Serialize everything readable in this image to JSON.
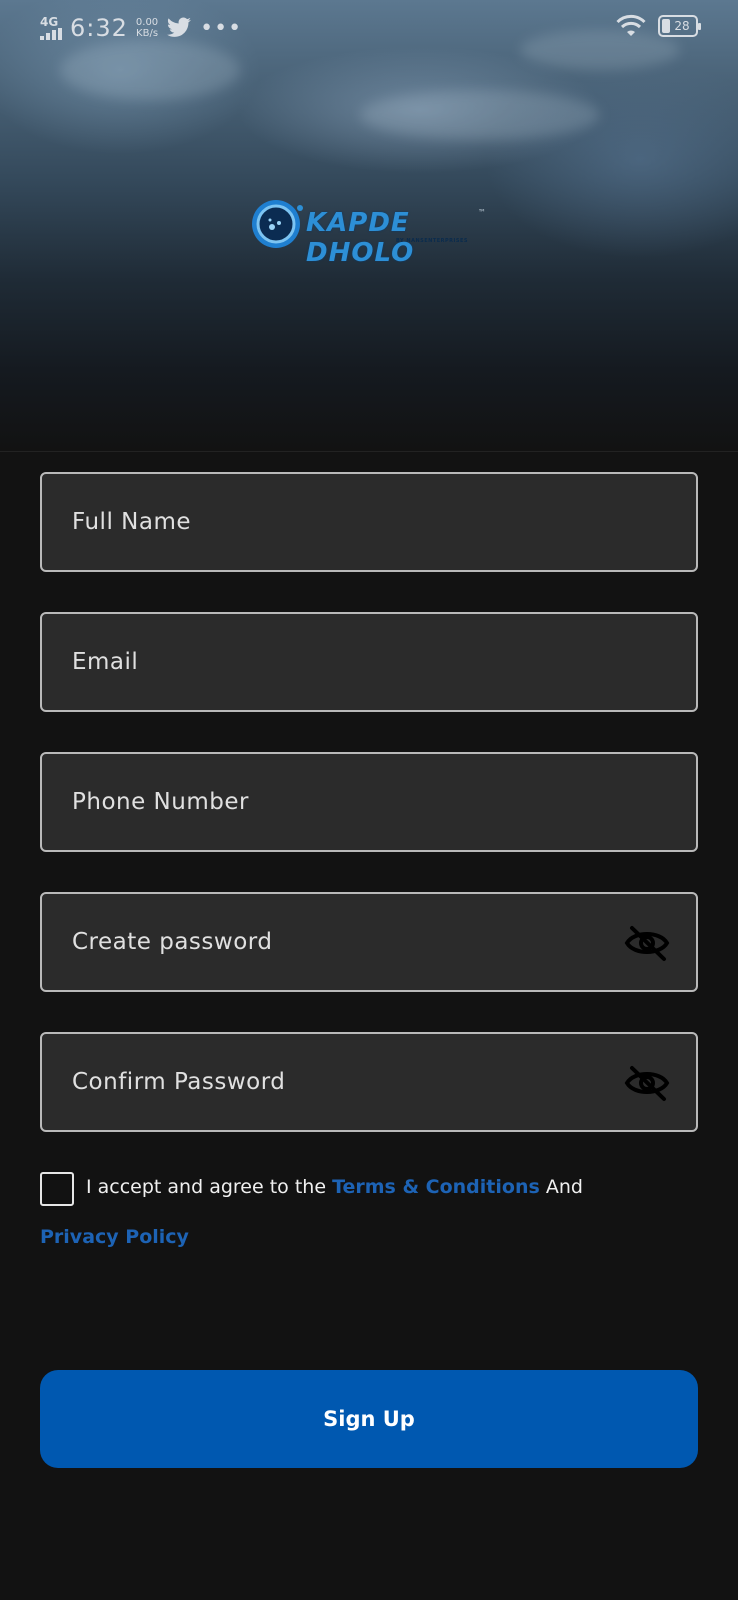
{
  "status_bar": {
    "network": "4G",
    "time": "6:32",
    "speed_value": "0.00",
    "speed_unit": "KB/s",
    "battery": "28",
    "overflow": "•••"
  },
  "brand": {
    "logo_text": "KAPDE DHOLO",
    "tagline": "BY NANSENTERPRISES",
    "trademark": "™"
  },
  "form": {
    "full_name": {
      "placeholder": "Full Name",
      "value": ""
    },
    "email": {
      "placeholder": "Email",
      "value": ""
    },
    "phone": {
      "placeholder": "Phone Number",
      "value": ""
    },
    "create_password": {
      "placeholder": "Create password",
      "value": ""
    },
    "confirm_password": {
      "placeholder": "Confirm Password",
      "value": ""
    }
  },
  "terms": {
    "prefix": "I accept and agree to the ",
    "terms_link": "Terms  & Conditions",
    "joiner": " And",
    "privacy_link": "Privacy Policy",
    "checked": false
  },
  "actions": {
    "signup_label": "Sign Up"
  },
  "colors": {
    "accent": "#0058b0",
    "link": "#1d63b5",
    "background": "#121212",
    "field_background": "#2b2b2b"
  }
}
